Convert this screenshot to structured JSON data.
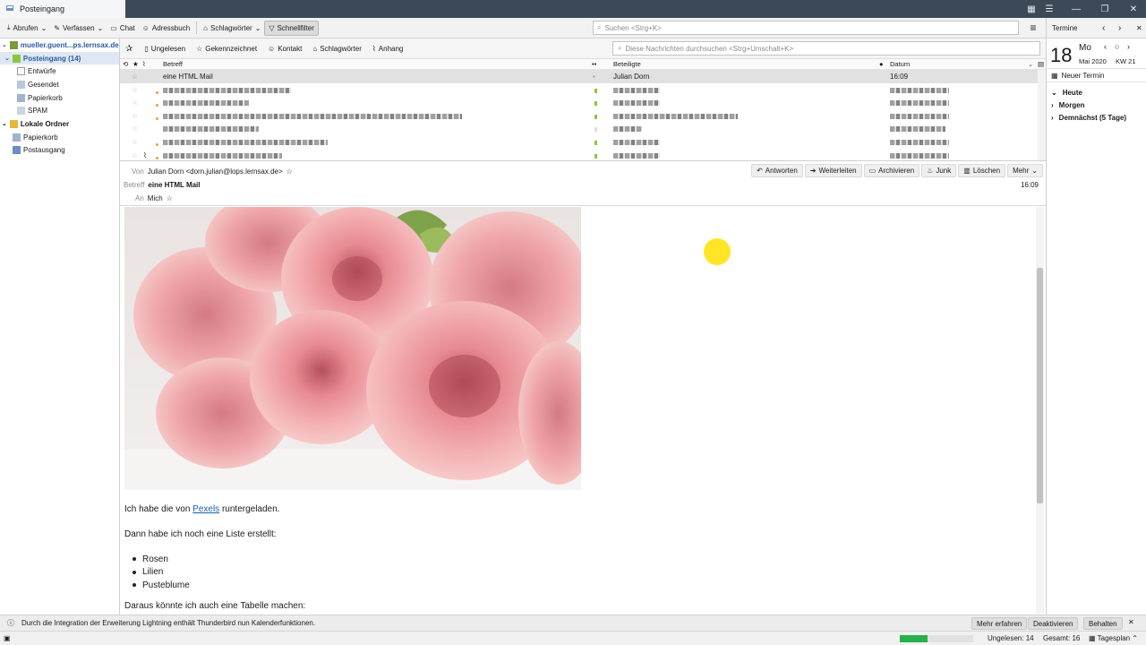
{
  "window": {
    "tab_title": "Posteingang"
  },
  "toolbar": {
    "get_messages": "Abrufen",
    "write": "Verfassen",
    "chat": "Chat",
    "address_book": "Adressbuch",
    "tags": "Schlagwörter",
    "quick_filter": "Schnellfilter",
    "search_placeholder": "Suchen <Strg+K>"
  },
  "folders": {
    "account": "mueller.guent...ps.lernsax.de",
    "inbox": "Posteingang (14)",
    "drafts": "Entwürfe",
    "sent": "Gesendet",
    "trash": "Papierkorb",
    "spam": "SPAM",
    "local_folders": "Lokale Ordner",
    "local_trash": "Papierkorb",
    "outbox": "Postausgang"
  },
  "quickfilter": {
    "unread": "Ungelesen",
    "starred": "Gekennzeichnet",
    "contact": "Kontakt",
    "tags": "Schlagwörter",
    "attachment": "Anhang",
    "search_placeholder": "Diese Nachrichten durchsuchen <Strg+Umschalt+K>"
  },
  "threadlist": {
    "columns": {
      "subject": "Betreff",
      "correspondents": "Beteiligte",
      "date": "Datum"
    },
    "selected_row": {
      "subject": "eine HTML Mail",
      "from": "Julian Dorn",
      "date": "16:09"
    }
  },
  "header": {
    "from_label": "Von",
    "from": "Julian Dorn <dorn.julian@lops.lernsax.de>",
    "subject_label": "Betreff",
    "subject": "eine HTML Mail",
    "to_label": "An",
    "to": "Mich",
    "time": "16:09",
    "buttons": {
      "reply": "Antworten",
      "forward": "Weiterleiten",
      "archive": "Archivieren",
      "junk": "Junk",
      "delete": "Löschen",
      "more": "Mehr"
    }
  },
  "body": {
    "line1_pre": "Ich habe die von ",
    "line1_link": "Pexels",
    "line1_post": " runtergeladen.",
    "line2": "Dann habe ich noch eine Liste erstellt:",
    "list": [
      "Rosen",
      "Lilien",
      "Pusteblume"
    ],
    "line3": "Daraus könnte ich auch eine Tabelle machen:"
  },
  "today_pane": {
    "title": "Termine",
    "day": "18",
    "weekday": "Mo",
    "month_year": "Mai 2020",
    "week": "KW 21",
    "new_event": "Neuer Termin",
    "today": "Heute",
    "tomorrow": "Morgen",
    "upcoming": "Demnächst (5 Tage)"
  },
  "notification": {
    "text": "Durch die Integration der Erweiterung Lightning enthält Thunderbird nun Kalenderfunktionen.",
    "learn_more": "Mehr erfahren",
    "disable": "Deaktivieren",
    "keep": "Behalten"
  },
  "status": {
    "unread": "Ungelesen: 14",
    "total": "Gesamt: 16",
    "schedule": "Tagesplan",
    "progress": 0.38
  },
  "colors": {
    "accent": "#2c5aa0",
    "link": "#1a5db5",
    "progress": "#26b14c",
    "titlebar": "#3c4a57"
  }
}
